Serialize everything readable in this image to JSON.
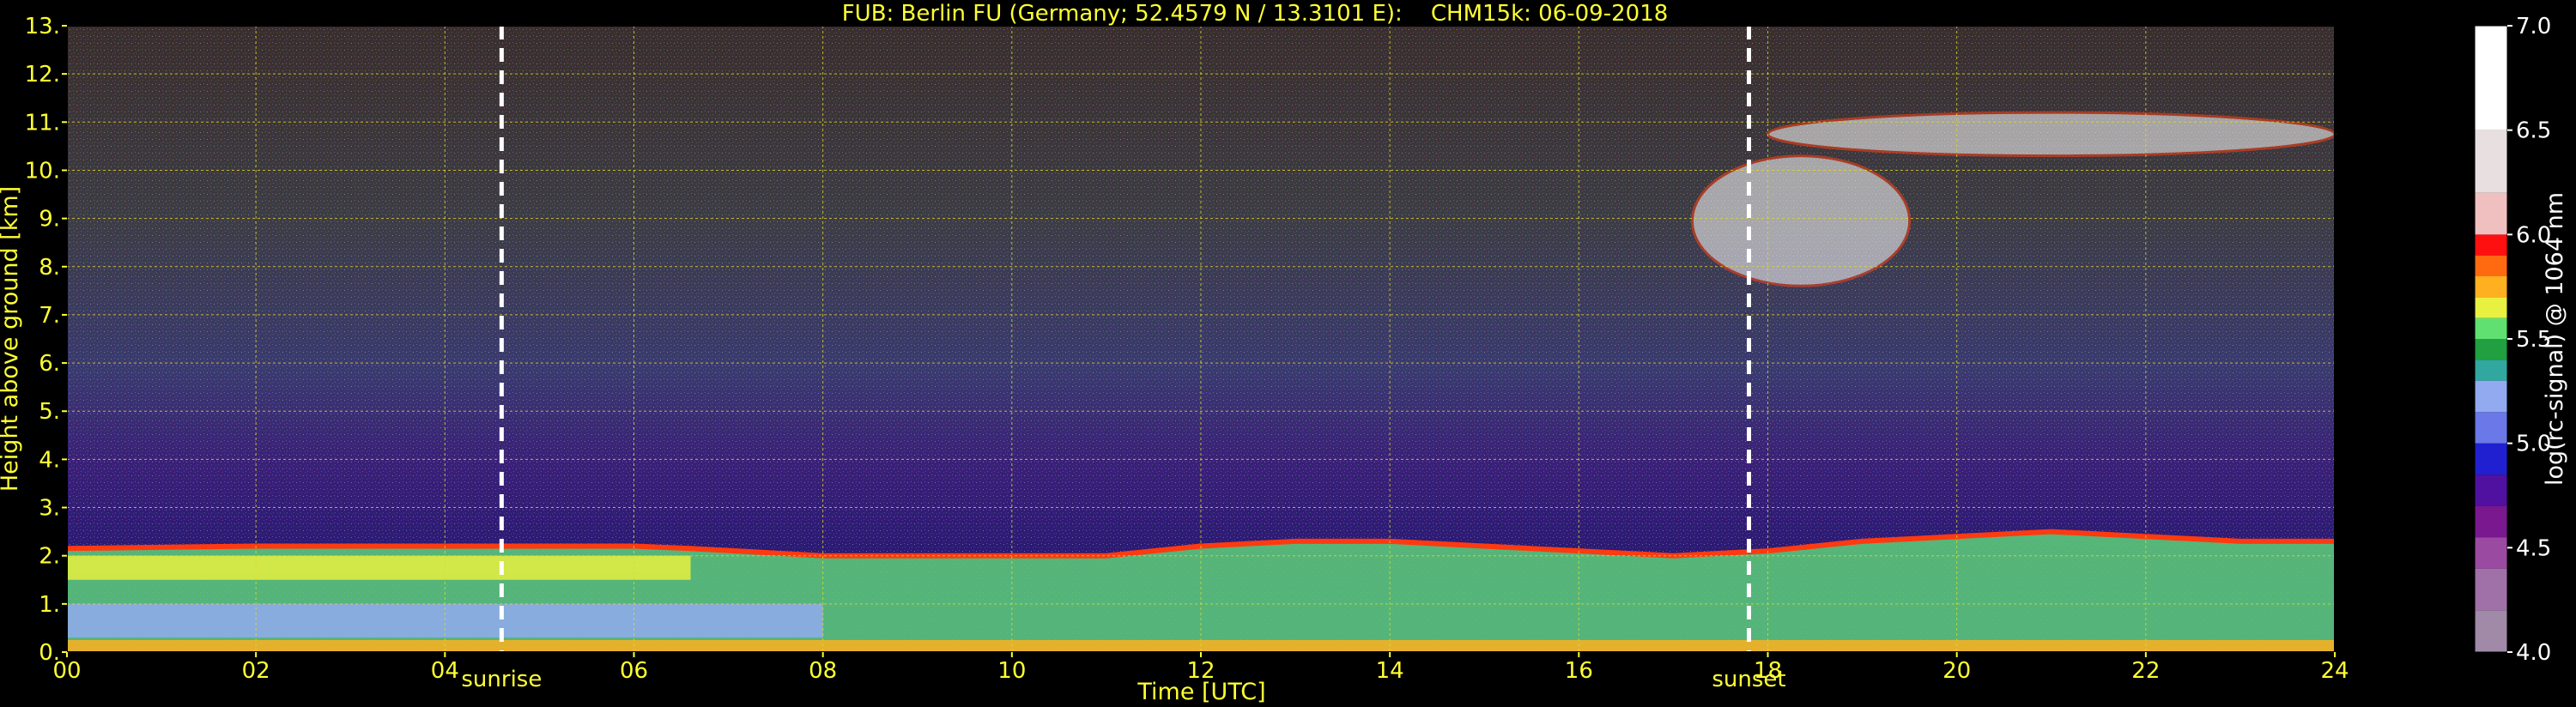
{
  "chart_data": {
    "type": "heatmap",
    "title": "FUB: Berlin FU (Germany; 52.4579 N / 13.3101 E):    CHM15k: 06-09-2018",
    "xlabel": "Time [UTC]",
    "ylabel": "Height above ground [km]",
    "xlim": [
      0,
      24
    ],
    "ylim": [
      0,
      13
    ],
    "x_ticks": [
      "00",
      "02",
      "04",
      "06",
      "08",
      "10",
      "12",
      "14",
      "16",
      "18",
      "20",
      "22",
      "24"
    ],
    "y_ticks": [
      "0.",
      "1.",
      "2.",
      "3.",
      "4.",
      "5.",
      "6.",
      "7.",
      "8.",
      "9.",
      "10.",
      "11.",
      "12.",
      "13."
    ],
    "grid": true,
    "event_markers": [
      {
        "label": "sunrise",
        "x": 4.6
      },
      {
        "label": "sunset",
        "x": 17.8
      }
    ],
    "colorbar": {
      "label": "log(rc-signal) @ 1064 nm",
      "range": [
        4.0,
        7.0
      ],
      "ticks": [
        "4.0",
        "4.5",
        "5.0",
        "5.5",
        "6.0",
        "6.5",
        "7.0"
      ],
      "stops": [
        {
          "v": 4.0,
          "color": "#a08aa8"
        },
        {
          "v": 4.2,
          "color": "#a070a8"
        },
        {
          "v": 4.4,
          "color": "#9a4aa0"
        },
        {
          "v": 4.55,
          "color": "#7a1890"
        },
        {
          "v": 4.7,
          "color": "#5010a0"
        },
        {
          "v": 4.85,
          "color": "#2020d0"
        },
        {
          "v": 5.0,
          "color": "#6a78e8"
        },
        {
          "v": 5.15,
          "color": "#92aaf0"
        },
        {
          "v": 5.3,
          "color": "#30a8a0"
        },
        {
          "v": 5.4,
          "color": "#20a040"
        },
        {
          "v": 5.5,
          "color": "#60e070"
        },
        {
          "v": 5.6,
          "color": "#e8f040"
        },
        {
          "v": 5.7,
          "color": "#ffb020"
        },
        {
          "v": 5.8,
          "color": "#ff6a10"
        },
        {
          "v": 5.9,
          "color": "#ff1010"
        },
        {
          "v": 6.0,
          "color": "#f0c0c0"
        },
        {
          "v": 6.2,
          "color": "#e8e0e0"
        },
        {
          "v": 6.5,
          "color": "#ffffff"
        },
        {
          "v": 7.0,
          "color": "#ffffff"
        }
      ]
    },
    "features": [
      {
        "name": "boundary-layer-top",
        "t": [
          0,
          2,
          4,
          6,
          6.6,
          8,
          10,
          11,
          12,
          13,
          14,
          15,
          16,
          17,
          18,
          19,
          20,
          21,
          22,
          23,
          24
        ],
        "height": [
          2.15,
          2.2,
          2.2,
          2.2,
          2.15,
          2.0,
          2.0,
          2.0,
          2.2,
          2.3,
          2.3,
          2.2,
          2.1,
          2.0,
          2.1,
          2.3,
          2.4,
          2.5,
          2.4,
          2.3,
          2.3
        ]
      },
      {
        "name": "mid-level-cloud",
        "t": [
          17.2,
          19.5
        ],
        "height": [
          7.6,
          10.3
        ]
      },
      {
        "name": "upper-cloud",
        "t": [
          18.0,
          24.0
        ],
        "height": [
          10.3,
          11.2
        ]
      }
    ]
  }
}
